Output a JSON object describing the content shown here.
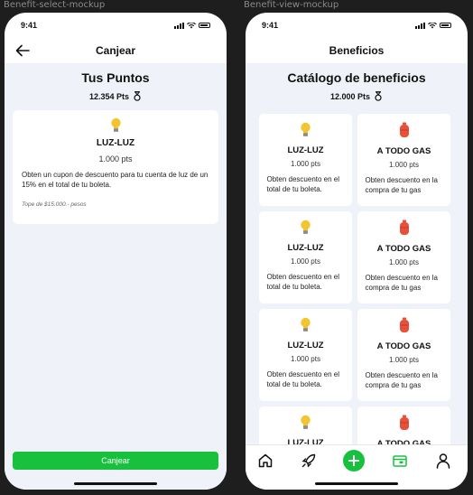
{
  "frames": {
    "left_label": "Benefit-select-mockup",
    "right_label": "Benefit-view-mockup"
  },
  "status_bar": {
    "time": "9:41"
  },
  "select_screen": {
    "header_title": "Canjear",
    "page_title": "Tus Puntos",
    "points": "12.354 Pts",
    "card": {
      "icon": "lightbulb-icon",
      "name": "LUZ-LUZ",
      "points": "1.000 pts",
      "description": "Obten un cupon de descuento para tu cuenta de luz de un 15% en el total de tu boleta.",
      "note": "Tope de $15.000.- pesos"
    },
    "button_label": "Canjear"
  },
  "view_screen": {
    "header_title": "Beneficios",
    "page_title": "Catálogo de beneficios",
    "points": "12.000 Pts",
    "tiles": [
      {
        "icon": "lightbulb-icon",
        "name": "LUZ-LUZ",
        "points": "1.000 pts",
        "description": "Obten descuento en el total de tu boleta."
      },
      {
        "icon": "gas-cylinder-icon",
        "name": "A TODO GAS",
        "points": "1.000 pts",
        "description": "Obten descuento en la compra de tu gas"
      },
      {
        "icon": "lightbulb-icon",
        "name": "LUZ-LUZ",
        "points": "1.000 pts",
        "description": "Obten descuento en el total de tu boleta."
      },
      {
        "icon": "gas-cylinder-icon",
        "name": "A TODO GAS",
        "points": "1.000 pts",
        "description": "Obten descuento en la compra de tu gas"
      },
      {
        "icon": "lightbulb-icon",
        "name": "LUZ-LUZ",
        "points": "1.000 pts",
        "description": "Obten descuento en el total de tu boleta."
      },
      {
        "icon": "gas-cylinder-icon",
        "name": "A TODO GAS",
        "points": "1.000 pts",
        "description": "Obten descuento en la compra de tu gas"
      },
      {
        "icon": "lightbulb-icon",
        "name": "LUZ-LUZ",
        "points": "",
        "description": ""
      },
      {
        "icon": "gas-cylinder-icon",
        "name": "A TODO GAS",
        "points": "",
        "description": ""
      }
    ],
    "tab_bar": [
      "home-icon",
      "rocket-icon",
      "add-icon",
      "wallet-icon",
      "profile-icon"
    ],
    "active_tab": "wallet-icon"
  },
  "colors": {
    "accent": "#17c13e",
    "background": "#eff2f8",
    "bulb": "#f4c430",
    "gas": "#e8503a"
  }
}
